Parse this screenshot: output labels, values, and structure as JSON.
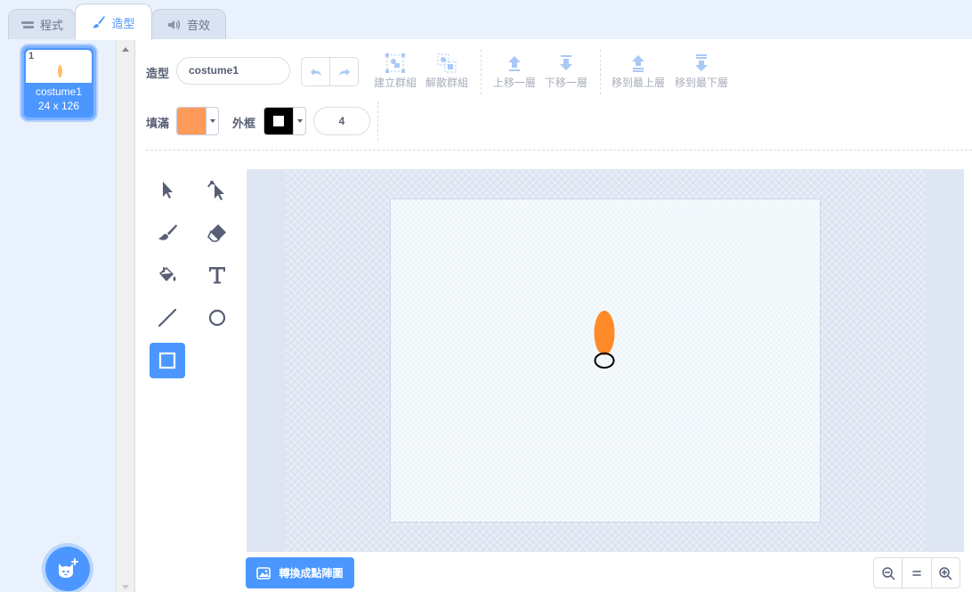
{
  "tabs": [
    {
      "label": "程式",
      "icon": "code-icon"
    },
    {
      "label": "造型",
      "icon": "brush-icon"
    },
    {
      "label": "音效",
      "icon": "speaker-icon"
    }
  ],
  "active_tab": "造型",
  "costume_list": {
    "items": [
      {
        "number": "1",
        "name": "costume1",
        "size": "24 x 126"
      }
    ],
    "add_button_icon": "cat-plus-icon"
  },
  "toolbar": {
    "costume_label": "造型",
    "costume_name": "costume1",
    "group_label": "建立群組",
    "ungroup_label": "解散群組",
    "forward_label": "上移一層",
    "backward_label": "下移一層",
    "front_label": "移到最上層",
    "back_label": "移到最下層",
    "fill_label": "填滿",
    "outline_label": "外框",
    "stroke_width": "4"
  },
  "colors": {
    "accent": "#4c97ff",
    "fill_color": "#ff9b5a",
    "outline_color": "#000000",
    "shape_color": "#ff8a2a"
  },
  "tools": [
    "select-tool",
    "reshape-tool",
    "brush-tool",
    "eraser-tool",
    "fill-tool",
    "text-tool",
    "line-tool",
    "circle-tool",
    "rectangle-tool"
  ],
  "selected_tool": "rectangle-tool",
  "footer": {
    "convert_label": "轉換成點陣圖",
    "zoom_out_icon": "zoom-out-icon",
    "zoom_reset_icon": "zoom-reset-icon",
    "zoom_in_icon": "zoom-in-icon"
  }
}
